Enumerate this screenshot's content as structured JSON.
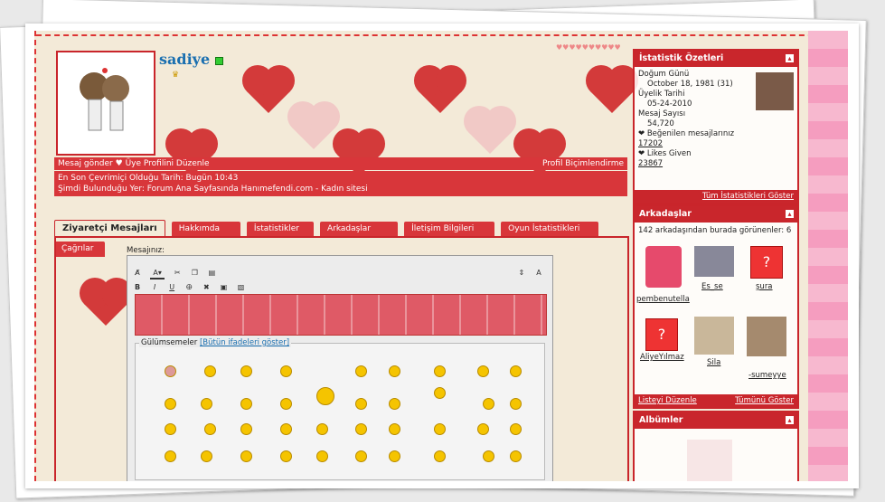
{
  "profile": {
    "username": "sadiye",
    "actions": [
      "Mesaj gönder",
      "Üye Profilini Düzenle"
    ],
    "customize_link": "Profil Biçimlendirme",
    "last_online": "En Son Çevrimiçi Olduğu Tarih: Bugün 10:43",
    "current_location": "Şimdi Bulunduğu Yer: Forum Ana Sayfasında Hanımefendi.com - Kadın sitesi"
  },
  "tabs": [
    "Ziyaretçi Mesajları",
    "Hakkımda",
    "İstatistikler",
    "Arkadaşlar",
    "İletişim Bilgileri",
    "Oyun İstatistikleri",
    "Çağrılar"
  ],
  "message_label": "Mesajınız:",
  "smilies": {
    "label": "Gülümsemeler",
    "show_all": "[Bütün ifadeleri göster]"
  },
  "stats": {
    "title": "İstatistik Özetleri",
    "birthday_label": "Doğum Günü",
    "birthday_value": "October 18, 1981 (31)",
    "member_since_label": "Üyelik Tarihi",
    "member_since_value": "05-24-2010",
    "posts_label": "Mesaj Sayısı",
    "posts_value": "54,720",
    "likes_label": "Beğenilen mesajlarınız",
    "likes_value": "17202",
    "likes_given_label": "Likes Given",
    "likes_given_value": "23867",
    "show_all": "Tüm İstatistikleri Göster"
  },
  "friends": {
    "title": "Arkadaşlar",
    "count_text": "142 arkadaşından burada görünenler: 6",
    "items": [
      "pembenutella",
      "Es_se",
      "şura",
      "AliyeYılmaz",
      "Sila",
      "-sumeyye"
    ],
    "edit_list": "Listeyi Düzenle",
    "show_all": "Tümünü Göster"
  },
  "albums": {
    "title": "Albümler"
  },
  "colors": {
    "accent": "#d8363a",
    "link": "#1a6fb0"
  }
}
